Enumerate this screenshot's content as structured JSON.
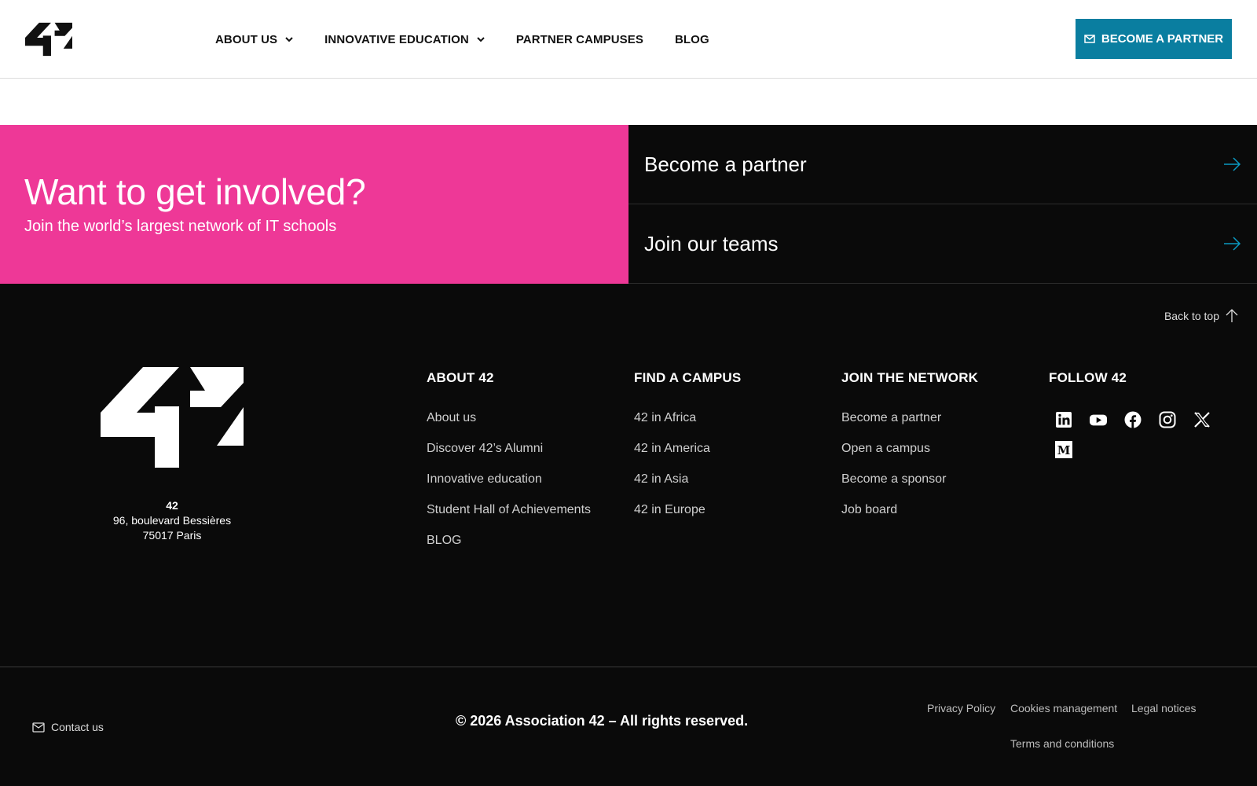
{
  "header": {
    "nav": [
      {
        "label": "ABOUT US",
        "dropdown": true
      },
      {
        "label": "INNOVATIVE EDUCATION",
        "dropdown": true
      },
      {
        "label": "PARTNER CAMPUSES",
        "dropdown": false
      },
      {
        "label": "BLOG",
        "dropdown": false
      }
    ],
    "cta_label": "BECOME A PARTNER"
  },
  "involve": {
    "title": "Want to get involved?",
    "subtitle": "Join the world’s largest network of IT schools",
    "links": [
      "Become a partner",
      "Join our teams"
    ]
  },
  "footer": {
    "back_to_top": "Back to top",
    "address": {
      "name": "42",
      "line1": "96, boulevard Bessières",
      "line2": "75017 Paris"
    },
    "columns": [
      {
        "title": "ABOUT 42",
        "links": [
          "About us",
          "Discover 42’s Alumni",
          "Innovative education",
          "Student Hall of Achievements",
          "BLOG"
        ]
      },
      {
        "title": "FIND A CAMPUS",
        "links": [
          "42 in Africa",
          "42 in America",
          "42 in Asia",
          "42 in Europe"
        ]
      },
      {
        "title": "JOIN THE NETWORK",
        "links": [
          "Become a partner",
          "Open a campus",
          "Become a sponsor",
          "Job board"
        ]
      },
      {
        "title": "FOLLOW 42",
        "links": []
      }
    ],
    "socials": [
      "linkedin-icon",
      "youtube-icon",
      "facebook-icon",
      "instagram-icon",
      "x-icon",
      "medium-icon"
    ]
  },
  "bottom": {
    "contact": "Contact us",
    "copyright": "© 2026 Association 42 – All rights reserved.",
    "legal": [
      "Privacy Policy",
      "Cookies management",
      "Legal notices",
      "Terms and conditions"
    ]
  },
  "colors": {
    "pink": "#ee3897",
    "teal": "#0a7ea0",
    "dark": "#0a0a0a"
  }
}
